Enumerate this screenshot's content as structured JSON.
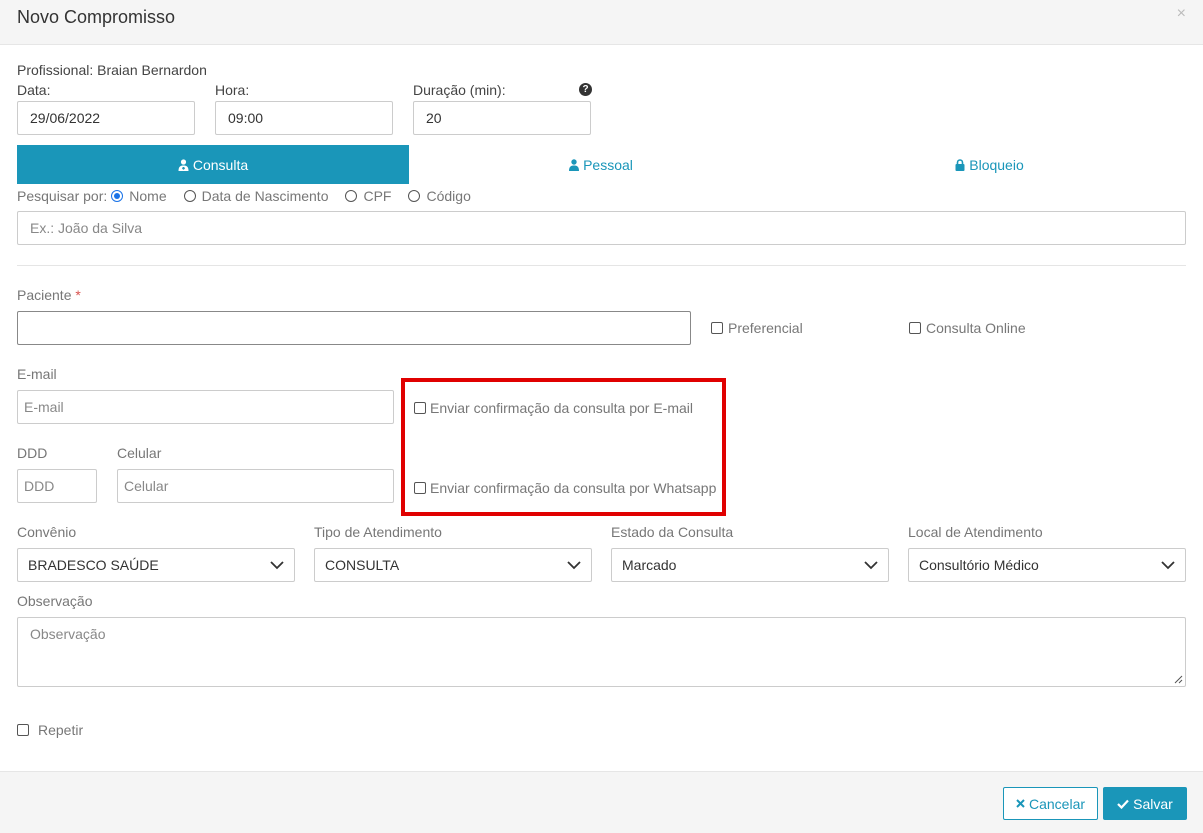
{
  "modal": {
    "title": "Novo Compromisso",
    "close": "×"
  },
  "professional": "Profissional: Braian Bernardon",
  "date": {
    "label": "Data:",
    "value": "29/06/2022"
  },
  "time": {
    "label": "Hora:",
    "value": "09:00"
  },
  "duration": {
    "label": "Duração (min):",
    "value": "20",
    "help": "?"
  },
  "tabs": [
    {
      "label": "Consulta",
      "icon": "user-md-icon"
    },
    {
      "label": "Pessoal",
      "icon": "user-icon"
    },
    {
      "label": "Bloqueio",
      "icon": "lock-icon"
    }
  ],
  "search": {
    "label": "Pesquisar por:",
    "options": [
      "Nome",
      "Data de Nascimento",
      "CPF",
      "Código"
    ],
    "selected": "Nome",
    "placeholder": "Ex.: João da Silva"
  },
  "patient": {
    "label": "Paciente",
    "required": "*",
    "value": ""
  },
  "checkboxes": {
    "preferencial": "Preferencial",
    "online": "Consulta Online"
  },
  "email": {
    "label": "E-mail",
    "placeholder": "E-mail"
  },
  "confirm": {
    "email": "Enviar confirmação da consulta por E-mail",
    "whatsapp": "Enviar confirmação da consulta por Whatsapp"
  },
  "ddd": {
    "label": "DDD",
    "placeholder": "DDD"
  },
  "phone": {
    "label": "Celular",
    "placeholder": "Celular"
  },
  "convenio": {
    "label": "Convênio",
    "value": "BRADESCO SAÚDE"
  },
  "tipo": {
    "label": "Tipo de Atendimento",
    "value": "CONSULTA"
  },
  "estado": {
    "label": "Estado da Consulta",
    "value": "Marcado"
  },
  "local": {
    "label": "Local de Atendimento",
    "value": "Consultório Médico"
  },
  "observacao": {
    "label": "Observação",
    "placeholder": "Observação"
  },
  "repeat": {
    "label": "Repetir"
  },
  "footer": {
    "cancel": "Cancelar",
    "save": "Salvar"
  },
  "colors": {
    "accent": "#1a96b9",
    "highlight": "#e00000"
  }
}
